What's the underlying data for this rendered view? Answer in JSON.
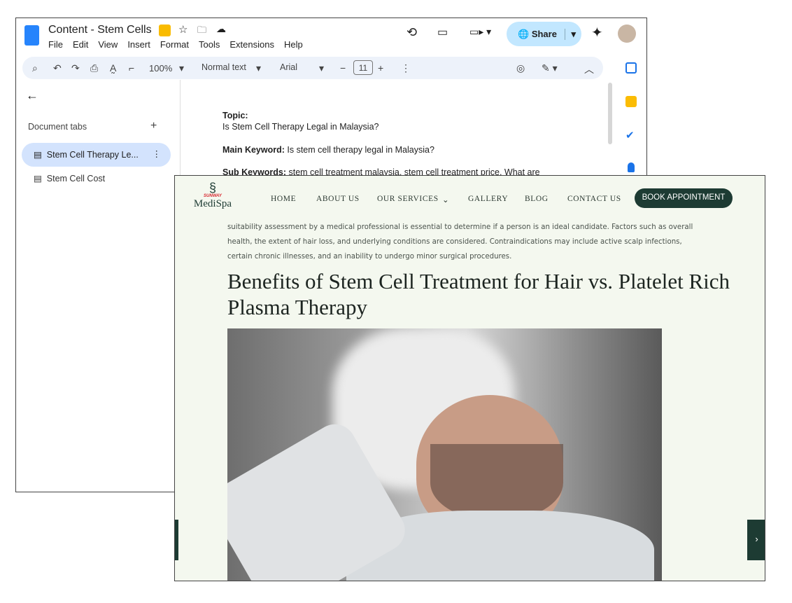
{
  "docs": {
    "title": "Content - Stem Cells",
    "menu": [
      "File",
      "Edit",
      "View",
      "Insert",
      "Format",
      "Tools",
      "Extensions",
      "Help"
    ],
    "share_label": "Share",
    "toolbar": {
      "zoom": "100%",
      "style": "Normal text",
      "font": "Arial",
      "font_size": "11"
    },
    "sidebar": {
      "heading": "Document tabs",
      "tabs": [
        "Stem Cell Therapy Le...",
        "Stem Cell Cost"
      ]
    },
    "body": {
      "topic_label": "Topic:",
      "topic": "Is Stem Cell Therapy Legal in Malaysia?",
      "main_kw_label": "Main Keyword:",
      "main_kw": " Is stem cell therapy legal in Malaysia?",
      "sub_kw_label": "Sub Keywords:",
      "sub_kw": " stem cell treatment malaysia, stem cell treatment price, What are"
    },
    "accent": "#c2e7ff"
  },
  "site": {
    "logo_top": "SUNWAY",
    "logo_name": "MediSpa",
    "nav": [
      "HOME",
      "ABOUT US",
      "OUR SERVICES",
      "GALLERY",
      "BLOG",
      "CONTACT US"
    ],
    "cta": "BOOK APPOINTMENT",
    "paragraph": "suitability assessment by a medical professional is essential to determine if a person is an ideal candidate. Factors such as overall health, the extent of hair loss, and underlying conditions are considered. Contraindications may include active scalp infections, certain chronic illnesses, and an inability to undergo minor surgical procedures.",
    "heading": "Benefits of Stem Cell Treatment for Hair vs. Platelet Rich Plasma Therapy",
    "brand_color": "#1d3b33"
  }
}
